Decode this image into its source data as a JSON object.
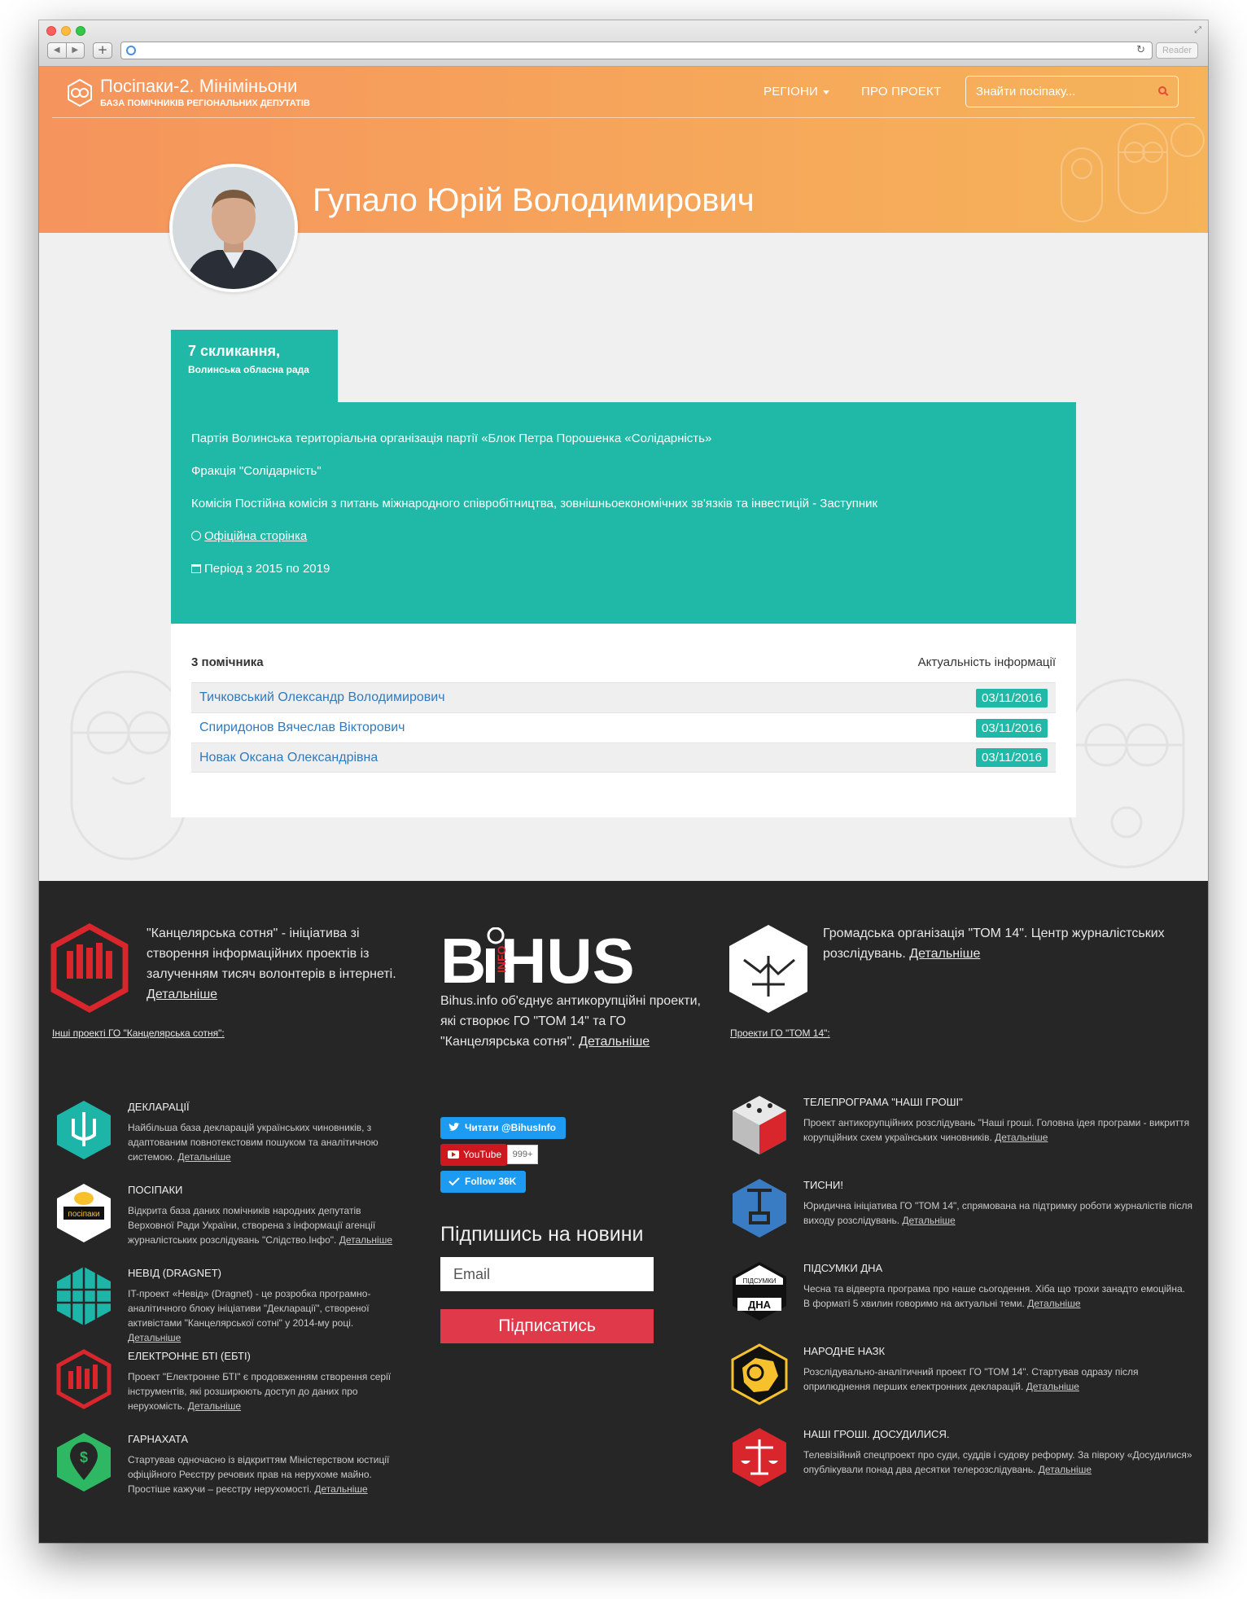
{
  "browser": {
    "reader_label": "Reader"
  },
  "header": {
    "title": "Посіпаки-2. Мініміньони",
    "subtitle": "БАЗА ПОМІЧНИКІВ РЕГІОНАЛЬНИХ ДЕПУТАТІВ",
    "nav_regions": "РЕГІОНИ",
    "nav_about": "ПРО ПРОЕКТ",
    "search_placeholder": "Знайти посіпаку..."
  },
  "person": {
    "name": "Гупало Юрій Володимирович"
  },
  "convocation": {
    "title": "7 скликання,",
    "council": "Волинська обласна рада",
    "party": "Партія Волинська територіальна організація партії «Блок Петра Порошенка «Солідарність»",
    "faction": "Фракція \"Солідарність\"",
    "commission": "Комісія Постійна комісія з питань міжнародного співробітництва, зовнішньоекономічних зв'язків та інвестицій - Заступник",
    "official_page": "Офіційна сторінка",
    "period": "Період з 2015 по 2019"
  },
  "assistants": {
    "count_label": "3 помічника",
    "actuality_label": "Актуальність інформації",
    "rows": [
      {
        "name": "Тичковський Олександр Володимирович",
        "date": "03/11/2016"
      },
      {
        "name": "Спиридонов Вячеслав Вікторович",
        "date": "03/11/2016"
      },
      {
        "name": "Новак Оксана Олександрівна",
        "date": "03/11/2016"
      }
    ]
  },
  "footer": {
    "sotnia_text": "\"Канцелярська сотня\" - ініціатива зі створення інформаційних проектів із залученням тисяч волонтерів в інтернеті.",
    "sotnia_more": "Детальніше",
    "sotnia_projects": "Інші проекті ГО \"Канцелярська сотня\":",
    "bihus_text": "Bihus.info об'єднує антикорупційні проекти, які створює ГО \"ТОМ 14\" та ГО \"Канцелярська сотня\".",
    "bihus_more": "Детальніше",
    "tom_text": "Громадська організація \"ТОМ 14\". Центр журналістських розслідувань.",
    "tom_more": "Детальніше",
    "tom_projects": "Проекти ГО \"ТОМ 14\":",
    "twitter_label": "Читати @BihusInfo",
    "youtube_label": "YouTube",
    "youtube_count": "999+",
    "follow_label": "Follow 36K",
    "subscribe_title": "Підпишись на новини",
    "email_placeholder": "Email",
    "subscribe_button": "Підписатись",
    "left_projects": [
      {
        "title": "ДЕКЛАРАЦІЇ",
        "desc": "Найбільша база декларацій українських чиновників, з адаптованим повнотекстовим пошуком та аналітичною системою.",
        "more": "Детальніше"
      },
      {
        "title": "ПОСІПАКИ",
        "desc": "Відкрита база даних помічників народних депутатів Верховної Ради України, створена з інформації агенції журналістських розслідувань \"Слідство.Інфо\".",
        "more": "Детальніше"
      },
      {
        "title": "НЕВІД (DRAGNET)",
        "desc": "IT-проект «Невід» (Dragnet) - це розробка програмно-аналітичного блоку ініціативи \"Декларації\", створеної активістами \"Канцелярської сотні\" у 2014-му році.",
        "more": "Детальніше"
      },
      {
        "title": "ЕЛЕКТРОННЕ БТІ (ЕБТІ)",
        "desc": "Проект \"Електронне БТІ\" є продовженням створення серії інструментів, які розширюють доступ до даних про нерухомість.",
        "more": "Детальніше"
      },
      {
        "title": "ГАРНАХАТА",
        "desc": "Стартував одночасно із відкриттям Міністерством юстиції офіційного Реєстру речових прав на нерухоме майно. Простіше кажучи – реєстру нерухомості.",
        "more": "Детальніше"
      }
    ],
    "right_projects": [
      {
        "title": "ТЕЛЕПРОГРАМА \"НАШІ ГРОШІ\"",
        "desc": "Проект антикорупційних розслідувань \"Наші гроші. Головна ідея програми - викриття корупційних схем українських чиновників.",
        "more": "Детальніше"
      },
      {
        "title": "ТИСНИ!",
        "desc": "Юридична ініціатива ГО \"ТОМ 14\", спрямована на підтримку роботи журналістів після виходу розслідувань.",
        "more": "Детальніше"
      },
      {
        "title": "ПІДСУМКИ ДНА",
        "desc": "Чесна та відверта програма про наше сьогодення. Хіба що трохи занадто емоційна. В форматі 5 хвилин говоримо на актуальні теми.",
        "more": "Детальніше"
      },
      {
        "title": "НАРОДНЕ НАЗК",
        "desc": "Розслідувально-аналітичний проект ГО \"ТОМ 14\". Стартував одразу після оприлюднення перших електронних декларацій.",
        "more": "Детальніше"
      },
      {
        "title": "НАШІ ГРОШІ. ДОСУДИЛИСЯ.",
        "desc": "Телевізійний спецпроект про суди, суддів і судову реформу. За півроку «Досудилися» опублікували понад два десятки телерозслідувань.",
        "more": "Детальніше"
      }
    ],
    "posipaky_icon_text": "посіпаки",
    "dna_icon_top": "ПІДСУМКИ",
    "dna_icon_bottom": "ДНА"
  }
}
